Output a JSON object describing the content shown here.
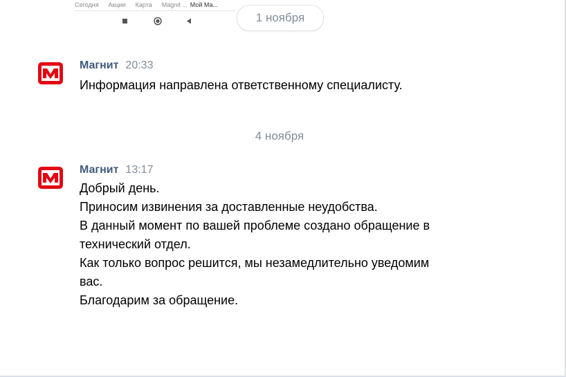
{
  "phone": {
    "tabs": [
      "Сегодня",
      "Акции",
      "Карта",
      "Magnit ...",
      "Мой Ма..."
    ]
  },
  "dates": {
    "first": "1 ноября",
    "second": "4 ноября"
  },
  "messages": [
    {
      "sender": "Магнит",
      "time": "20:33",
      "lines": [
        "Информация направлена ответственному специалисту."
      ]
    },
    {
      "sender": "Магнит",
      "time": "13:17",
      "lines": [
        "Добрый день.",
        "Приносим извинения за доставленные неудобства.",
        "В данный момент по вашей проблеме создано обращение в",
        "технический отдел.",
        "Как только вопрос решится, мы незамедлительно уведомим",
        "вас.",
        "Благодарим за обращение."
      ]
    }
  ],
  "colors": {
    "brand_red": "#e30613",
    "sender": "#3f5a7a",
    "meta_gray": "#818c99"
  }
}
